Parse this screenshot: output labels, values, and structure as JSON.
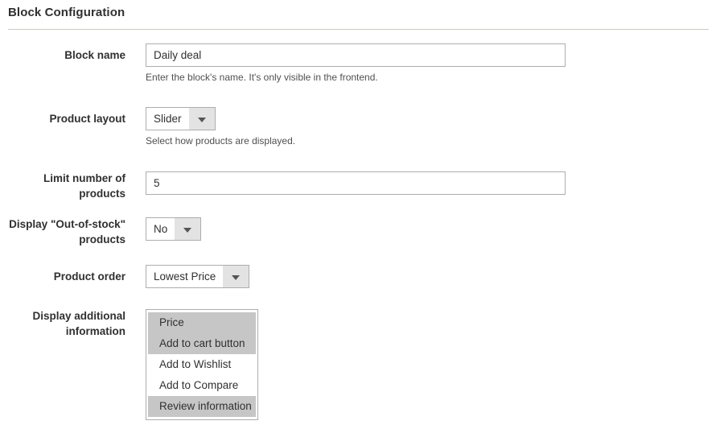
{
  "section": {
    "title": "Block Configuration"
  },
  "fields": {
    "block_name": {
      "label": "Block name",
      "value": "Daily deal",
      "placeholder": "",
      "note": "Enter the block's name. It's only visible in the frontend."
    },
    "product_layout": {
      "label": "Product layout",
      "value": "Slider",
      "note": "Select how products are displayed."
    },
    "limit_number": {
      "label": "Limit number of products",
      "value": "5",
      "placeholder": ""
    },
    "out_of_stock": {
      "label": "Display \"Out-of-stock\" products",
      "value": "No"
    },
    "product_order": {
      "label": "Product order",
      "value": "Lowest Price"
    },
    "additional_information": {
      "label": "Display additional information",
      "options": [
        {
          "label": "Price",
          "selected": true
        },
        {
          "label": "Add to cart button",
          "selected": true
        },
        {
          "label": "Add to Wishlist",
          "selected": false
        },
        {
          "label": "Add to Compare",
          "selected": false
        },
        {
          "label": "Review information",
          "selected": true
        }
      ]
    }
  },
  "colors": {
    "divider": "#cfcabb",
    "border": "#adadad",
    "select_button": "#e3e3e3",
    "option_selected": "#c6c6c6",
    "text": "#303030",
    "note_text": "#505050"
  }
}
